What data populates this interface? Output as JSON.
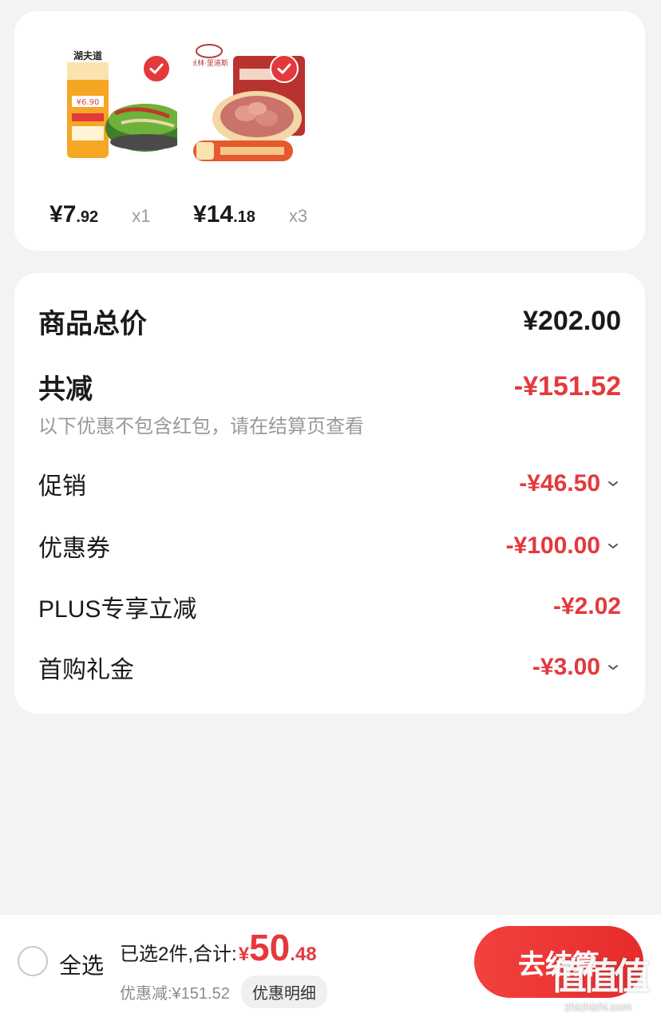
{
  "products": [
    {
      "image": "noodle-bowl-product-image",
      "checked": true,
      "yen": "¥",
      "price_int": "7",
      "price_dec": ".92",
      "qty": "x1"
    },
    {
      "image": "sliced-meat-product-image",
      "checked": true,
      "yen": "¥",
      "price_int": "14",
      "price_dec": ".18",
      "qty": "x3"
    }
  ],
  "summary": {
    "total_label": "商品总价",
    "total_value": "¥202.00",
    "reduce_label": "共减",
    "reduce_value": "-¥151.52",
    "note": "以下优惠不包含红包，请在结算页查看",
    "items": [
      {
        "label": "促销",
        "value": "-¥46.50",
        "expandable": true
      },
      {
        "label": "优惠券",
        "value": "-¥100.00",
        "expandable": true
      },
      {
        "label": "PLUS专享立减",
        "value": "-¥2.02",
        "expandable": false
      },
      {
        "label": "首购礼金",
        "value": "-¥3.00",
        "expandable": true
      }
    ]
  },
  "bottom_bar": {
    "select_all": "全选",
    "selected_text": "已选2件,合计:",
    "total_yen": "¥",
    "total_int": "50",
    "total_dec": ".48",
    "discount_text": "优惠减:¥151.52",
    "detail_button": "优惠明细",
    "checkout_button": "去结算"
  },
  "watermark": {
    "logo": "值值值",
    "text": "zhizhizhi.com"
  },
  "colors": {
    "accent_red": "#e4393c",
    "background": "#f3f3f3",
    "card": "#ffffff"
  }
}
